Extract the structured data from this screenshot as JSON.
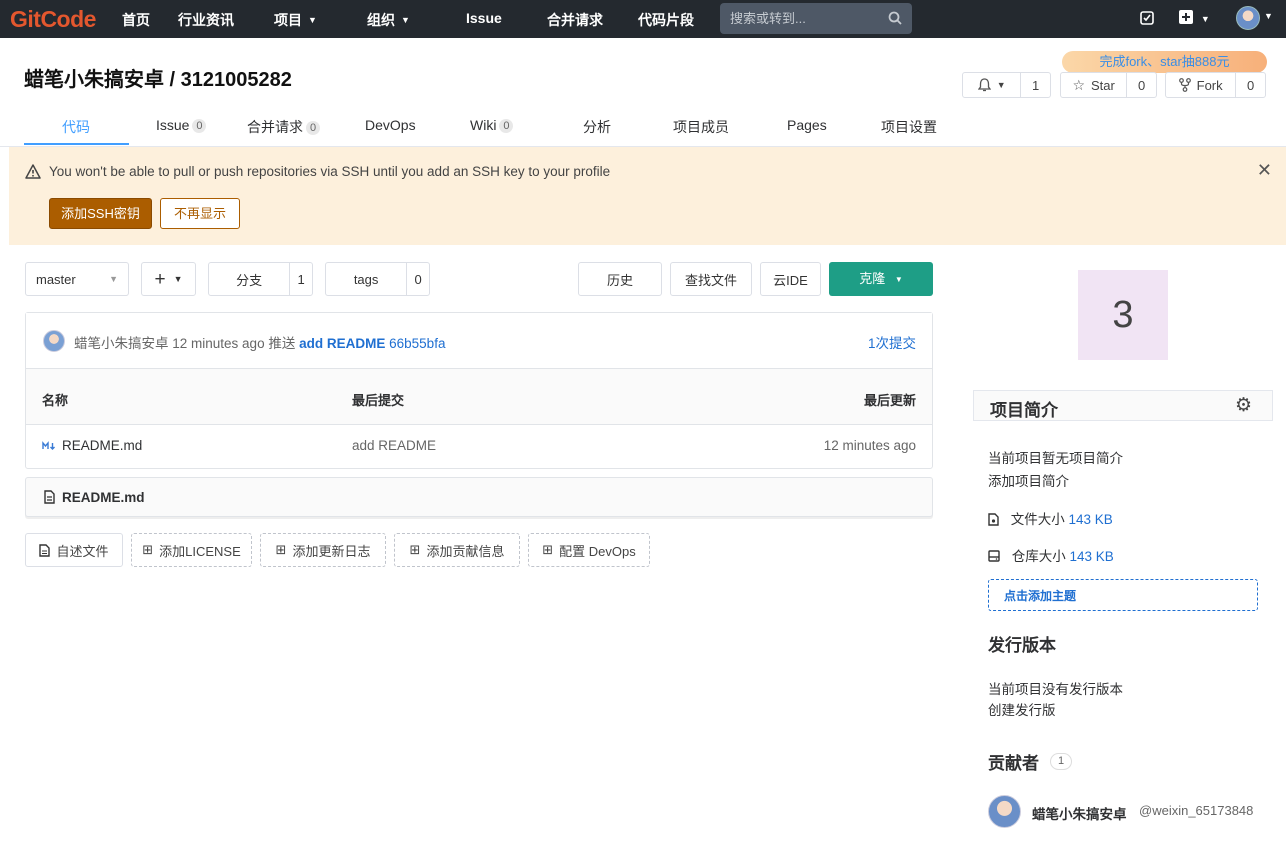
{
  "topnav": {
    "logo": "GitCode",
    "items": [
      "首页",
      "行业资讯",
      "项目",
      "组织",
      "Issue",
      "合并请求",
      "代码片段"
    ],
    "search_placeholder": "搜索或转到..."
  },
  "header": {
    "repo_title": "蜡笔小朱搞安卓 / 3121005282",
    "promo": "完成fork、star抽888元",
    "watch_count": "1",
    "star_label": "Star",
    "star_count": "0",
    "fork_label": "Fork",
    "fork_count": "0"
  },
  "tabs": [
    {
      "label": "代码"
    },
    {
      "label": "Issue",
      "count": "0"
    },
    {
      "label": "合并请求",
      "count": "0"
    },
    {
      "label": "DevOps"
    },
    {
      "label": "Wiki",
      "count": "0"
    },
    {
      "label": "分析"
    },
    {
      "label": "项目成员"
    },
    {
      "label": "Pages"
    },
    {
      "label": "项目设置"
    }
  ],
  "alert": {
    "message": "You won't be able to pull or push repositories via SSH until you add an SSH key to your profile",
    "primary_button": "添加SSH密钥",
    "secondary_button": "不再显示"
  },
  "toolbar": {
    "branch": "master",
    "branches_label": "分支",
    "branches_count": "1",
    "tags_label": "tags",
    "tags_count": "0",
    "history": "历史",
    "find_file": "查找文件",
    "cloud_ide": "云IDE",
    "clone": "克隆"
  },
  "commit": {
    "author": "蜡笔小朱搞安卓",
    "time": "12 minutes ago",
    "action": "推送",
    "message": "add README",
    "hash": "66b55bfa",
    "count_label": "1次提交"
  },
  "file_table": {
    "headers": [
      "名称",
      "最后提交",
      "最后更新"
    ],
    "rows": [
      {
        "name": "README.md",
        "last_commit": "add README",
        "updated": "12 minutes ago"
      }
    ]
  },
  "readme_title": "README.md",
  "actions": [
    "自述文件",
    "添加LICENSE",
    "添加更新日志",
    "添加贡献信息",
    "配置 DevOps"
  ],
  "sidebar": {
    "avatar_letter": "3",
    "intro_title": "项目简介",
    "no_desc": "当前项目暂无项目简介",
    "add_desc": "添加项目简介",
    "file_size_label": "文件大小",
    "file_size": "143 KB",
    "repo_size_label": "仓库大小",
    "repo_size": "143 KB",
    "add_topic": "点击添加主题",
    "release_title": "发行版本",
    "no_release": "当前项目没有发行版本",
    "create_release": "创建发行版",
    "contributors_title": "贡献者",
    "contributors_count": "1",
    "contributor_name": "蜡笔小朱搞安卓",
    "contributor_handle": "@weixin_65173848"
  },
  "colors": {
    "topbar": "#24292f",
    "accent": "#409eff",
    "clone_button": "#1e9e86",
    "alert_bg": "#fdf0dc",
    "ssh_button": "#ab5d00"
  }
}
